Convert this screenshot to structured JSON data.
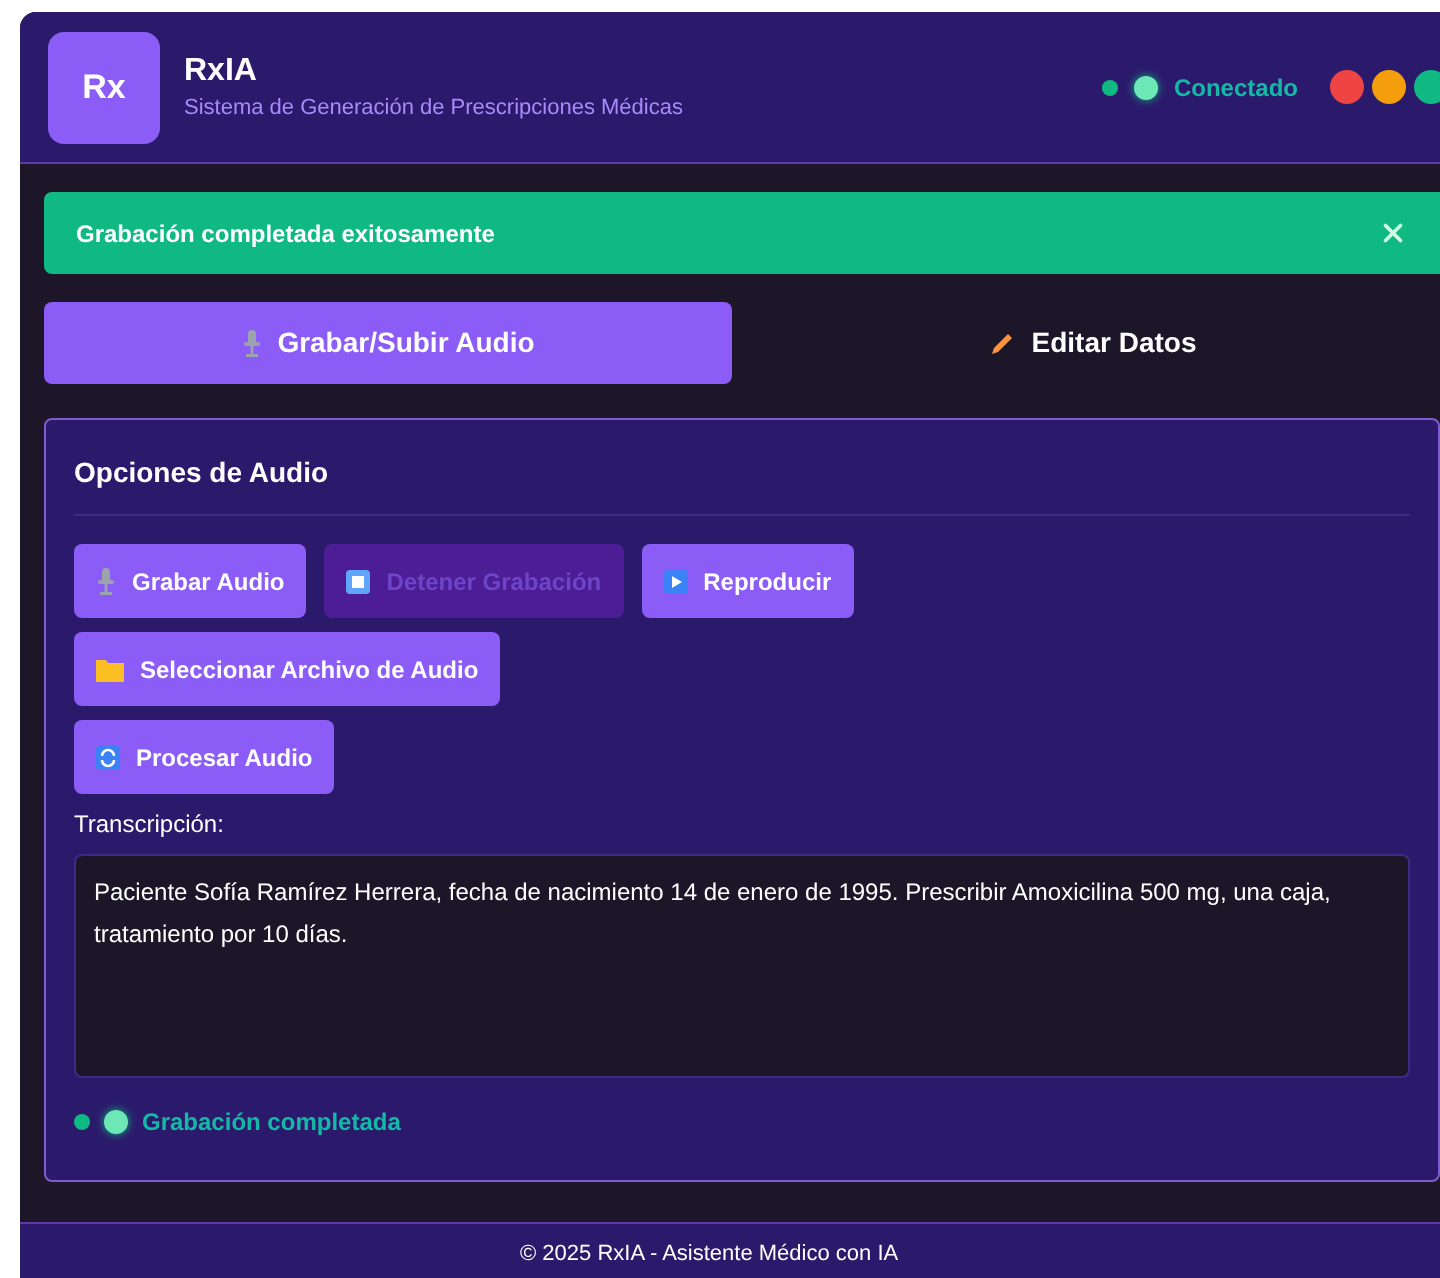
{
  "header": {
    "logo": "Rx",
    "title": "RxIA",
    "subtitle": "Sistema de Generación de Prescripciones Médicas",
    "connection": {
      "label": "Conectado",
      "connected": true
    }
  },
  "alert": {
    "message": "Grabación completada exitosamente"
  },
  "tabs": [
    {
      "label": "Grabar/Subir Audio",
      "kind": "record",
      "selected": true
    },
    {
      "label": "Editar Datos",
      "kind": "edit",
      "selected": false
    }
  ],
  "panel": {
    "title": "Opciones de Audio",
    "button_rows": [
      [
        {
          "label": "Grabar Audio",
          "kind": "record",
          "disabled": false
        },
        {
          "label": "Detener Grabación",
          "kind": "stop",
          "disabled": true
        },
        {
          "label": "Reproducir",
          "kind": "play",
          "disabled": false
        }
      ],
      [
        {
          "label": "Seleccionar Archivo de Audio",
          "kind": "select",
          "disabled": false
        }
      ],
      [
        {
          "label": "Procesar Audio",
          "kind": "process",
          "disabled": false
        }
      ]
    ],
    "transcription": {
      "label": "Transcripción:",
      "value": "Paciente Sofía Ramírez Herrera, fecha de nacimiento 14 de enero de 1995. Prescribir Amoxicilina 500 mg, una caja, tratamiento por 10 días."
    },
    "status": {
      "label": "Grabación completada",
      "done": true
    }
  },
  "footer": "© 2025 RxIA - Asistente Médico con IA"
}
